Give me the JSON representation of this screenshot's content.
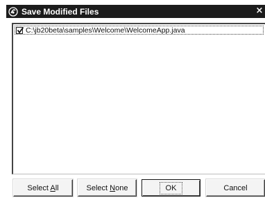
{
  "window": {
    "title": "Save Modified Files",
    "close_glyph": "×"
  },
  "files": [
    {
      "path": "C:\\jb20beta\\samples\\Welcome\\WelcomeApp.java",
      "checked": true
    }
  ],
  "buttons": {
    "select_all": {
      "pre": "Select ",
      "accel": "A",
      "post": "ll"
    },
    "select_none": {
      "pre": "Select ",
      "accel": "N",
      "post": "one"
    },
    "ok": "OK",
    "cancel": "Cancel"
  },
  "icons": {
    "app": "jbuilder-app-icon",
    "close": "close-icon",
    "check": "checkmark-icon"
  }
}
